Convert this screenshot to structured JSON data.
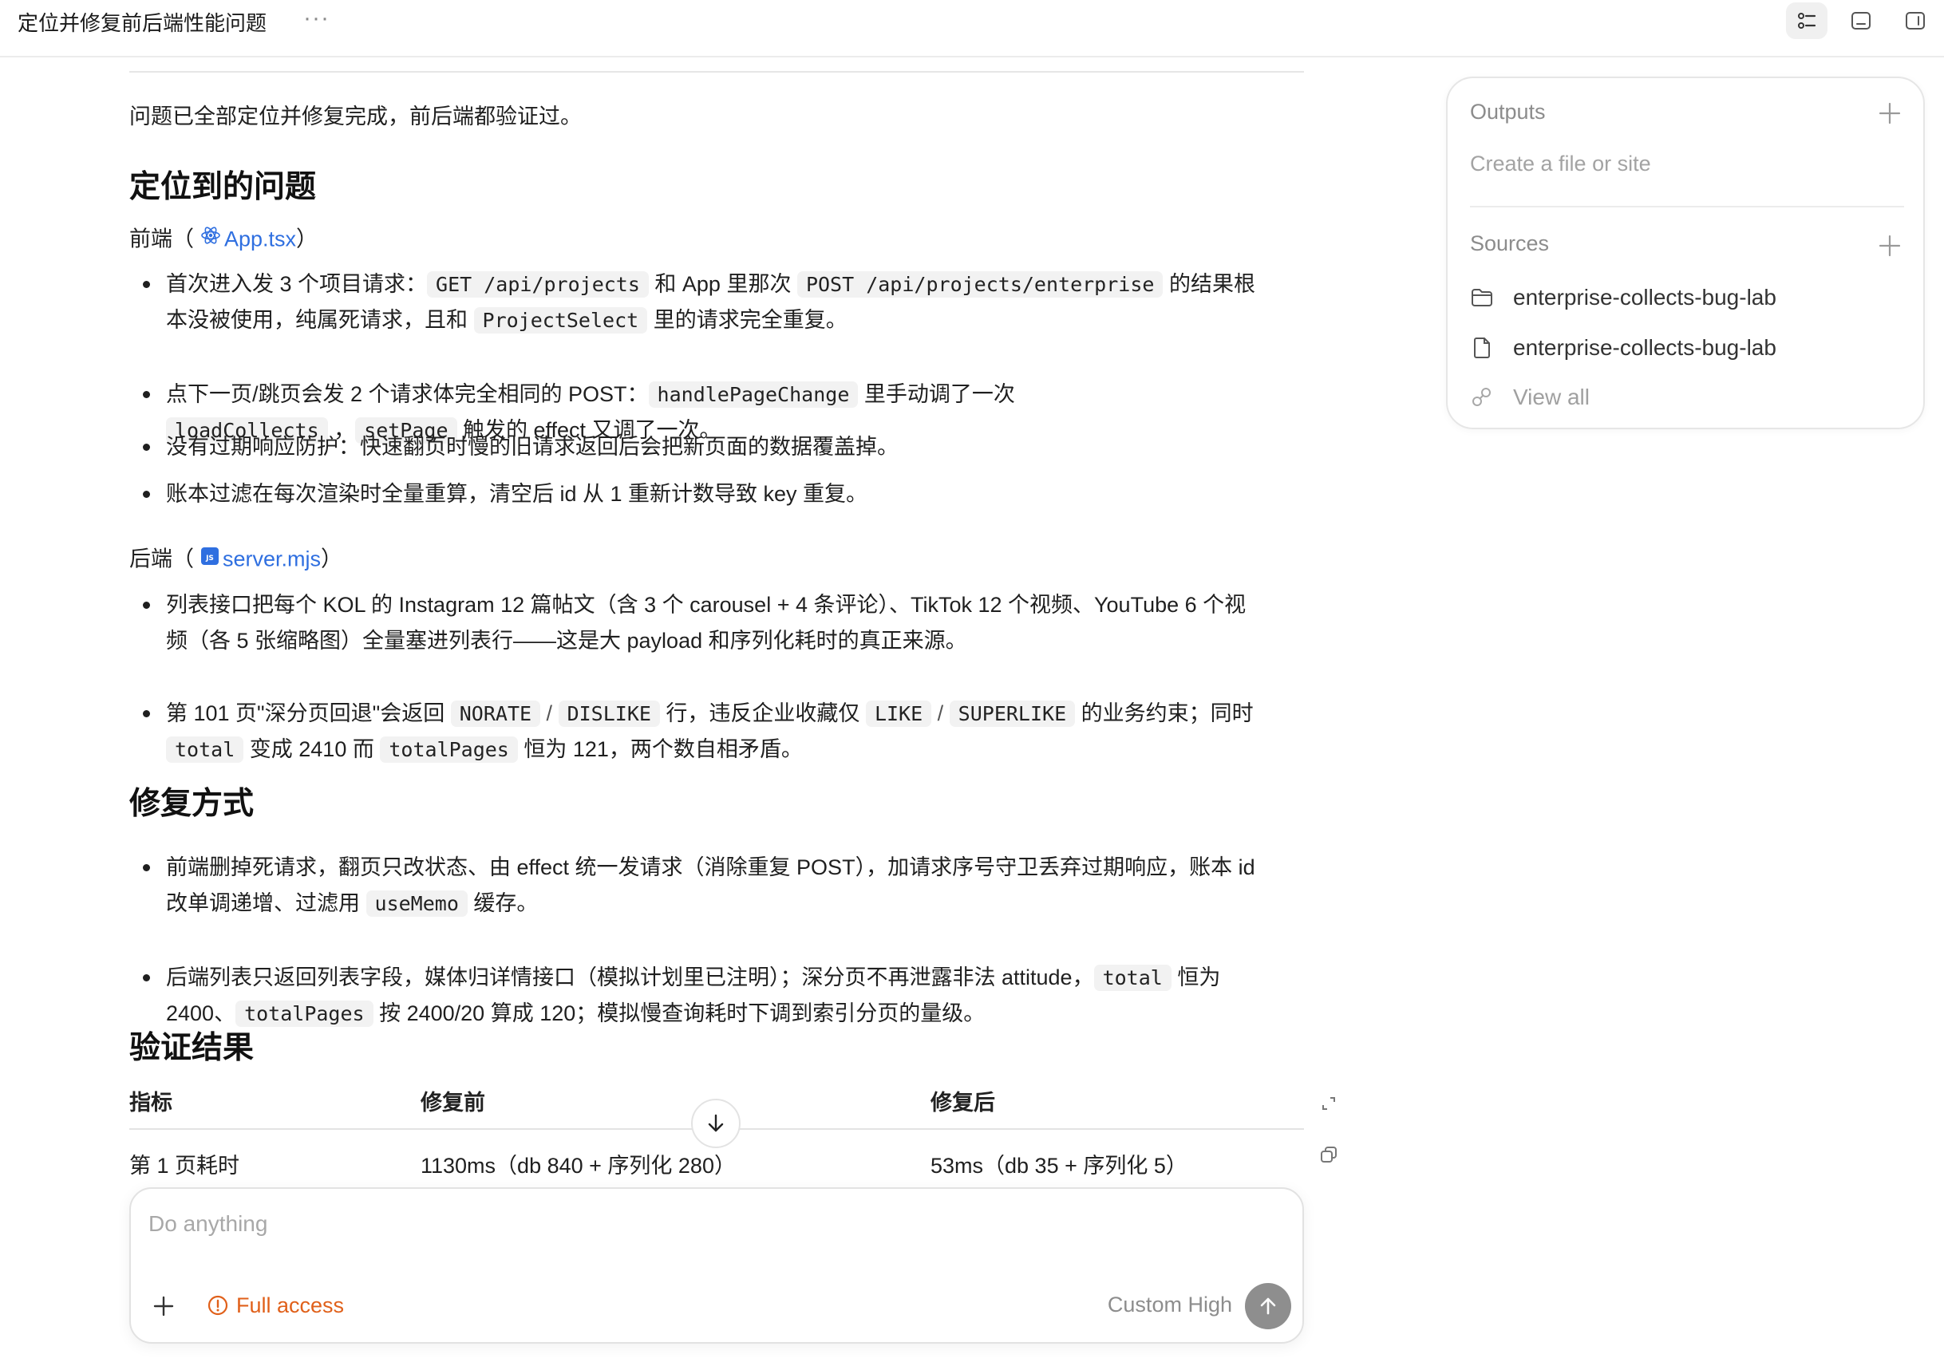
{
  "window": {
    "title": "定位并修复前后端性能问题",
    "more_label": "···"
  },
  "content": {
    "intro": "问题已全部定位并修复完成，前后端都验证过。",
    "section1_title": "定位到的问题",
    "frontend": {
      "label": "前端（",
      "file": "App.tsx",
      "close": "）",
      "bullets": [
        {
          "lines": [
            [
              {
                "t": "首次进入发 3 个项目请求："
              },
              {
                "c": "GET /api/projects"
              },
              {
                "t": " 和 App 里那次 "
              },
              {
                "c": "POST /api/projects/enterprise"
              },
              {
                "t": " 的结果根"
              }
            ],
            [
              {
                "t": "本没被使用，纯属死请求，且和 "
              },
              {
                "c": "ProjectSelect"
              },
              {
                "t": " 里的请求完全重复。"
              }
            ]
          ]
        },
        {
          "lines": [
            [
              {
                "t": "点下一页/跳页会发 2 个请求体完全相同的 POST："
              },
              {
                "c": "handlePageChange"
              },
              {
                "t": " 里手动调了一次"
              }
            ],
            [
              {
                "c": "loadCollects"
              },
              {
                "t": " ，"
              },
              {
                "c": "setPage"
              },
              {
                "t": " 触发的 effect 又调了一次。"
              }
            ]
          ]
        },
        {
          "lines": [
            [
              {
                "t": "没有过期响应防护：快速翻页时慢的旧请求返回后会把新页面的数据覆盖掉。"
              }
            ]
          ]
        },
        {
          "lines": [
            [
              {
                "t": "账本过滤在每次渲染时全量重算，清空后 id 从 1 重新计数导致 key 重复。"
              }
            ]
          ]
        }
      ]
    },
    "backend": {
      "label": "后端（",
      "file": "server.mjs",
      "close": "）",
      "bullets": [
        {
          "lines": [
            [
              {
                "t": "列表接口把每个 KOL 的 Instagram 12 篇帖文（含 3 个 carousel + 4 条评论）、TikTok 12 个视频、YouTube 6 个视"
              }
            ],
            [
              {
                "t": "频（各 5 张缩略图）全量塞进列表行——这是大 payload 和序列化耗时的真正来源。"
              }
            ]
          ]
        },
        {
          "lines": [
            [
              {
                "t": "第 101 页\"深分页回退\"会返回 "
              },
              {
                "c": "NORATE"
              },
              {
                "s": " / "
              },
              {
                "c": "DISLIKE"
              },
              {
                "t": " 行，违反企业收藏仅 "
              },
              {
                "c": "LIKE"
              },
              {
                "s": " / "
              },
              {
                "c": "SUPERLIKE"
              },
              {
                "t": " 的业务约束；同时"
              }
            ],
            [
              {
                "c": "total"
              },
              {
                "t": " 变成 2410 而 "
              },
              {
                "c": "totalPages"
              },
              {
                "t": " 恒为 121，两个数自相矛盾。"
              }
            ]
          ]
        }
      ]
    },
    "section2_title": "修复方式",
    "fixes": [
      {
        "lines": [
          [
            {
              "t": "前端删掉死请求，翻页只改状态、由 effect 统一发请求（消除重复 POST），加请求序号守卫丢弃过期响应，账本 id"
            }
          ],
          [
            {
              "t": "改单调递增、过滤用 "
            },
            {
              "c": "useMemo"
            },
            {
              "t": " 缓存。"
            }
          ]
        ]
      },
      {
        "lines": [
          [
            {
              "t": "后端列表只返回列表字段，媒体归详情接口（模拟计划里已注明）；深分页不再泄露非法 attitude，"
            },
            {
              "c": "total"
            },
            {
              "t": " 恒为"
            }
          ],
          [
            {
              "t": "2400、"
            },
            {
              "c": "totalPages"
            },
            {
              "t": " 按 2400/20 算成 120；模拟慢查询耗时下调到索引分页的量级。"
            }
          ]
        ]
      }
    ],
    "section3_title": "验证结果",
    "table": {
      "headers": [
        "指标",
        "修复前",
        "修复后"
      ],
      "rows": [
        [
          "第 1 页耗时",
          "1130ms（db 840 + 序列化 280）",
          "53ms（db 35 + 序列化 5）"
        ]
      ]
    }
  },
  "composer": {
    "placeholder": "Do anything",
    "access_label": "Full access",
    "model_label": "Custom",
    "effort_label": "High"
  },
  "panel": {
    "outputs_title": "Outputs",
    "outputs_empty": "Create a file or site",
    "sources_title": "Sources",
    "sources": [
      {
        "icon": "folder-icon",
        "label": "enterprise-collects-bug-lab"
      },
      {
        "icon": "file-icon",
        "label": "enterprise-collects-bug-lab"
      }
    ],
    "view_all": "View all"
  },
  "colors": {
    "link": "#2f6fe0",
    "warning": "#e0601a",
    "send_button": "#8e8e8e"
  }
}
